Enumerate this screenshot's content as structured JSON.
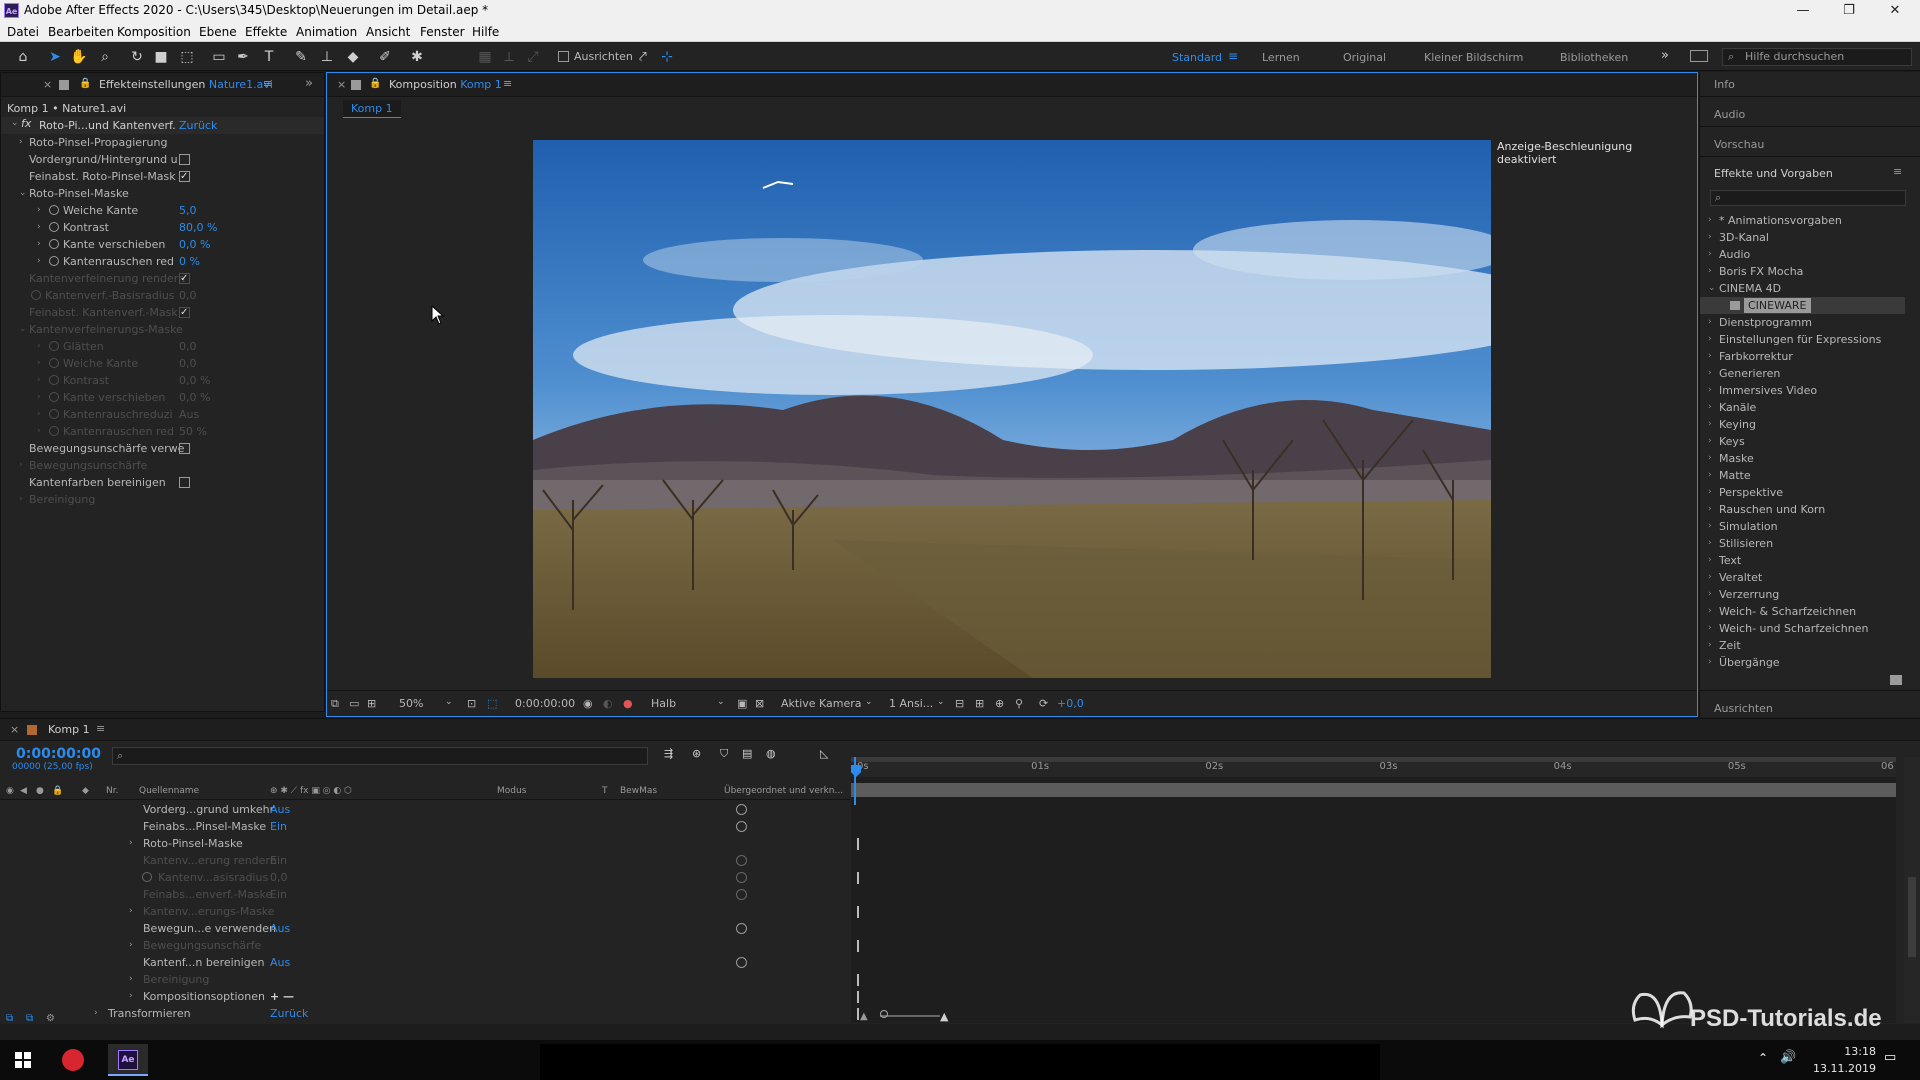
{
  "window": {
    "title": "Adobe After Effects 2020 - C:\\Users\\345\\Desktop\\Neuerungen im Detail.aep *"
  },
  "menu": [
    "Datei",
    "Bearbeiten",
    "Komposition",
    "Ebene",
    "Effekte",
    "Animation",
    "Ansicht",
    "Fenster",
    "Hilfe"
  ],
  "toolbar": {
    "align_label": "Ausrichten",
    "workspaces": [
      "Standard",
      "Lernen",
      "Original",
      "Kleiner Bildschirm",
      "Bibliotheken"
    ],
    "active_workspace": "Standard",
    "help_placeholder": "Hilfe durchsuchen"
  },
  "effect_controls": {
    "tab_prefix": "Effekteinstellungen",
    "tab_file": "Nature1.avi",
    "header": "Komp 1 • Nature1.avi",
    "effect_name": "Roto-Pi...und Kantenverf.",
    "reset": "Zurück",
    "rows": [
      {
        "label": "Roto-Pinsel-Propagierung",
        "type": "group",
        "indent": 1,
        "disabled": false
      },
      {
        "label": "Vordergrund/Hintergrund u",
        "type": "check",
        "checked": false,
        "indent": 1,
        "disabled": false
      },
      {
        "label": "Feinabst. Roto-Pinsel-Mask",
        "type": "check",
        "checked": true,
        "indent": 1,
        "disabled": false
      },
      {
        "label": "Roto-Pinsel-Maske",
        "type": "group-open",
        "indent": 1,
        "disabled": false
      },
      {
        "label": "Weiche Kante",
        "type": "value",
        "value": "5,0",
        "indent": 2,
        "disabled": false
      },
      {
        "label": "Kontrast",
        "type": "value",
        "value": "80,0 %",
        "indent": 2,
        "disabled": false
      },
      {
        "label": "Kante verschieben",
        "type": "value",
        "value": "0,0 %",
        "indent": 2,
        "disabled": false
      },
      {
        "label": "Kantenrauschen red",
        "type": "value",
        "value": "0 %",
        "indent": 2,
        "disabled": false
      },
      {
        "label": "Kantenverfeinerung rendern",
        "type": "check",
        "checked": true,
        "indent": 1,
        "disabled": true
      },
      {
        "label": "Kantenverf.-Basisradius",
        "type": "value",
        "value": "0,0",
        "indent": 1,
        "disabled": true
      },
      {
        "label": "Feinabst. Kantenverf.-Mask",
        "type": "check",
        "checked": true,
        "indent": 1,
        "disabled": true
      },
      {
        "label": "Kantenverfeinerungs-Maske",
        "type": "group-open",
        "indent": 1,
        "disabled": true
      },
      {
        "label": "Glätten",
        "type": "value",
        "value": "0,0",
        "indent": 2,
        "disabled": true
      },
      {
        "label": "Weiche Kante",
        "type": "value",
        "value": "0,0",
        "indent": 2,
        "disabled": true
      },
      {
        "label": "Kontrast",
        "type": "value",
        "value": "0,0 %",
        "indent": 2,
        "disabled": true
      },
      {
        "label": "Kante verschieben",
        "type": "value",
        "value": "0,0 %",
        "indent": 2,
        "disabled": true
      },
      {
        "label": "Kantenrauschreduzi",
        "type": "value",
        "value": "Aus",
        "indent": 2,
        "disabled": true
      },
      {
        "label": "Kantenrauschen red",
        "type": "value",
        "value": "50 %",
        "indent": 2,
        "disabled": true
      },
      {
        "label": "Bewegungsunschärfe verwe",
        "type": "check",
        "checked": false,
        "indent": 1,
        "disabled": false
      },
      {
        "label": "Bewegungsunschärfe",
        "type": "group",
        "indent": 1,
        "disabled": true
      },
      {
        "label": "Kantenfarben bereinigen",
        "type": "check",
        "checked": false,
        "indent": 1,
        "disabled": false
      },
      {
        "label": "Bereinigung",
        "type": "group",
        "indent": 1,
        "disabled": true
      }
    ]
  },
  "composition": {
    "tab_prefix": "Komposition",
    "tab_name": "Komp 1",
    "subtab": "Komp 1",
    "gpu_notice": "Anzeige-Beschleunigung deaktiviert",
    "footer": {
      "zoom": "50%",
      "timecode": "0:00:00:00",
      "resolution": "Halb",
      "camera": "Aktive Kamera",
      "views": "1 Ansi...",
      "exposure": "+0,0"
    }
  },
  "right_panel": {
    "headers": [
      "Info",
      "Audio",
      "Vorschau",
      "Effekte und Vorgaben"
    ],
    "bottom_header": "Ausrichten",
    "search_placeholder": "",
    "categories": [
      "* Animationsvorgaben",
      "3D-Kanal",
      "Audio",
      "Boris FX Mocha",
      "CINEMA 4D",
      "CINEWARE",
      "Dienstprogramm",
      "Einstellungen für Expressions",
      "Farbkorrektur",
      "Generieren",
      "Immersives Video",
      "Kanäle",
      "Keying",
      "Keys",
      "Maske",
      "Matte",
      "Perspektive",
      "Rauschen und Korn",
      "Simulation",
      "Stilisieren",
      "Text",
      "Veraltet",
      "Verzerrung",
      "Weich- & Scharfzeichnen",
      "Weich- und Scharfzeichnen",
      "Zeit",
      "Übergänge"
    ]
  },
  "timeline": {
    "tab": "Komp 1",
    "timecode": "0:00:00:00",
    "frame_info": "00000 (25,00 fps)",
    "columns": {
      "nr": "Nr.",
      "source": "Quellenname",
      "mode": "Modus",
      "t": "T",
      "trkmat": "BewMas",
      "parent": "Übergeordnet und verkn..."
    },
    "rows": [
      {
        "label": "Vorderg...grund umkehr",
        "value": "Aus",
        "indent": 2,
        "disabled": false,
        "spiral": true,
        "key": false
      },
      {
        "label": "Feinabs...Pinsel-Maske",
        "value": "Ein",
        "indent": 2,
        "disabled": false,
        "spiral": true,
        "key": false
      },
      {
        "label": "Roto-Pinsel-Maske",
        "value": "",
        "indent": 2,
        "disabled": false,
        "spiral": false,
        "key": true,
        "group": true
      },
      {
        "label": "Kantenv...erung rendern",
        "value": "Ein",
        "indent": 2,
        "disabled": true,
        "spiral": true,
        "key": false
      },
      {
        "label": "Kantenv...asisradius",
        "value": "0,0",
        "indent": 3,
        "disabled": true,
        "spiral": true,
        "key": true
      },
      {
        "label": "Feinabs...enverf.-Maske",
        "value": "Ein",
        "indent": 2,
        "disabled": true,
        "spiral": true,
        "key": false
      },
      {
        "label": "Kantenv...erungs-Maske",
        "value": "",
        "indent": 2,
        "disabled": true,
        "spiral": false,
        "key": true,
        "group": true
      },
      {
        "label": "Bewegun...e verwenden",
        "value": "Aus",
        "indent": 2,
        "disabled": false,
        "spiral": true,
        "key": false
      },
      {
        "label": "Bewegungsunschärfe",
        "value": "",
        "indent": 2,
        "disabled": true,
        "spiral": false,
        "key": true,
        "group": true
      },
      {
        "label": "Kantenf...n bereinigen",
        "value": "Aus",
        "indent": 2,
        "disabled": false,
        "spiral": true,
        "key": false
      },
      {
        "label": "Bereinigung",
        "value": "",
        "indent": 2,
        "disabled": true,
        "spiral": false,
        "key": true,
        "group": true
      },
      {
        "label": "Kompositionsoptionen",
        "value": "+ —",
        "indent": 2,
        "disabled": false,
        "spiral": false,
        "key": true,
        "group": true
      },
      {
        "label": "Transformieren",
        "value": "Zurück",
        "indent": 1,
        "disabled": false,
        "spiral": false,
        "key": true,
        "group": true
      }
    ],
    "ruler": [
      "0s",
      "01s",
      "02s",
      "03s",
      "04s",
      "05s",
      "06"
    ]
  },
  "taskbar": {
    "time": "13:18",
    "date": "13.11.2019"
  },
  "watermark": "PSD-Tutorials.de",
  "colors": {
    "accent": "#2d8ceb",
    "panel": "#232323",
    "background": "#1d1d1d"
  }
}
